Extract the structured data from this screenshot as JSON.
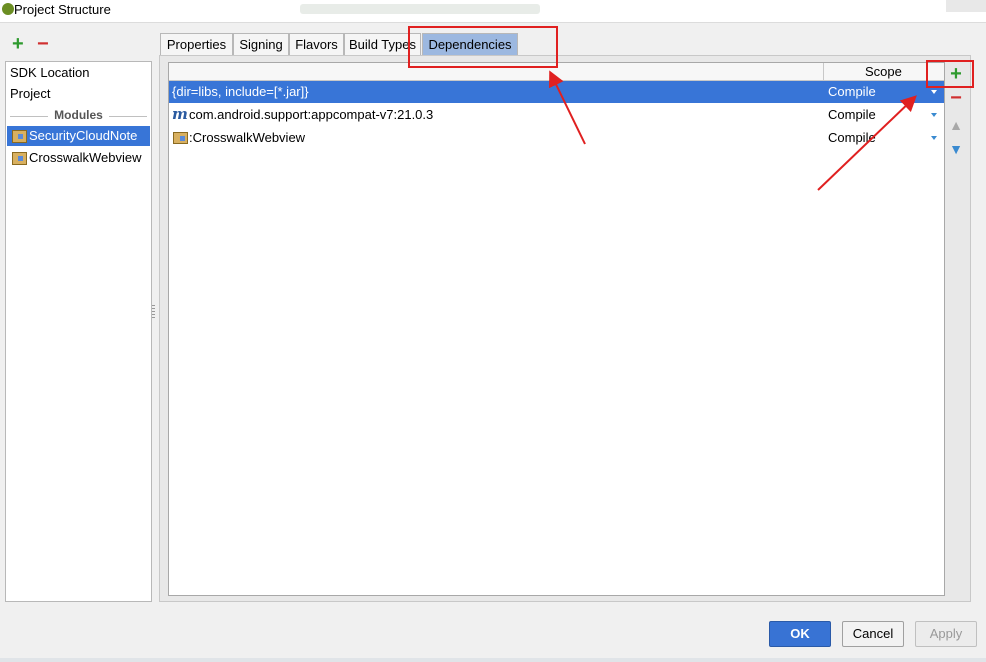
{
  "window": {
    "title": "Project Structure"
  },
  "left_toolbar": {
    "add_icon": "plus-icon",
    "remove_icon": "minus-icon"
  },
  "sidebar": {
    "items": [
      {
        "label": "SDK Location"
      },
      {
        "label": "Project"
      }
    ],
    "modules_header": "Modules",
    "modules": [
      {
        "label": "SecurityCloudNote",
        "selected": true
      },
      {
        "label": "CrosswalkWebview",
        "selected": false
      }
    ]
  },
  "tabs": [
    {
      "label": "Properties"
    },
    {
      "label": "Signing"
    },
    {
      "label": "Flavors"
    },
    {
      "label": "Build Types"
    },
    {
      "label": "Dependencies",
      "active": true
    }
  ],
  "table": {
    "scope_header": "Scope",
    "rows": [
      {
        "name": "{dir=libs, include=[*.jar]}",
        "scope": "Compile",
        "icon": "none",
        "selected": true
      },
      {
        "name": "com.android.support:appcompat-v7:21.0.3",
        "scope": "Compile",
        "icon": "maven-icon",
        "selected": false
      },
      {
        "name": ":CrosswalkWebview",
        "scope": "Compile",
        "icon": "module-folder-icon",
        "selected": false
      }
    ]
  },
  "right_toolbar": {
    "add_icon": "plus-icon",
    "remove_icon": "minus-icon",
    "up_icon": "arrow-up-icon",
    "down_icon": "arrow-down-icon"
  },
  "buttons": {
    "ok": "OK",
    "cancel": "Cancel",
    "apply": "Apply"
  },
  "colors": {
    "selection": "#3875d7",
    "annotation": "#e02020",
    "active_tab": "#9cb8e0"
  }
}
